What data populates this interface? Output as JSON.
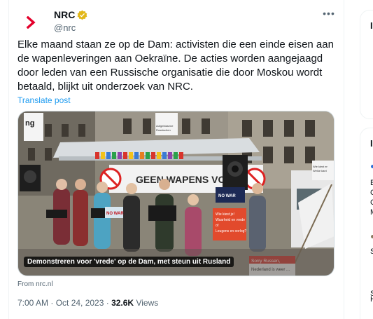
{
  "tweet": {
    "author_name": "NRC",
    "author_handle": "@nrc",
    "more_glyph": "•••",
    "text": "Elke maand staan ze op de Dam: activisten die een einde eisen aan de wapenleveringen aan Oekraïne. De acties worden aangejaagd door leden van een Russische organisatie die door Moskou wordt betaald, blijkt uit onderzoek van NRC.",
    "translate_label": "Translate post",
    "media": {
      "caption": "Demonstreren voor 'vrede' op de Dam, met steun uit Rusland",
      "banner_text": "GEEN WAPENS VOOR",
      "sign_left_top": "Aufgeblasene",
      "sign_left_bottom": "Russischen",
      "sign_right_top": "Wie kiest er",
      "sign_right_bottom": "Welke kant",
      "placard_1": "Wie kiest je!",
      "placard_2": "Waarheid en vrede",
      "placard_3": "of",
      "placard_4": "Leugens en oorlog?",
      "sorry_1": "Sorry Russen,",
      "sorry_2": "Nederland is weer ...",
      "music_stand_sign": "NO WAR",
      "speaker_sign": "NO WAR"
    },
    "source_label": "From nrc.nl",
    "timestamp": "7:00 AM · Oct 24, 2023 ·",
    "views_count": "32.6K",
    "views_label": "Views"
  },
  "sidebar": {
    "card1_letter": "I",
    "card2_letter": "I",
    "card2_items": [
      "E",
      "C",
      "C",
      "M",
      "S",
      "S",
      "H"
    ]
  },
  "colors": {
    "brand_red": "#e4002b",
    "verified_gold": "#e2b719",
    "link_blue": "#1d9bf0",
    "muted": "#536471"
  }
}
